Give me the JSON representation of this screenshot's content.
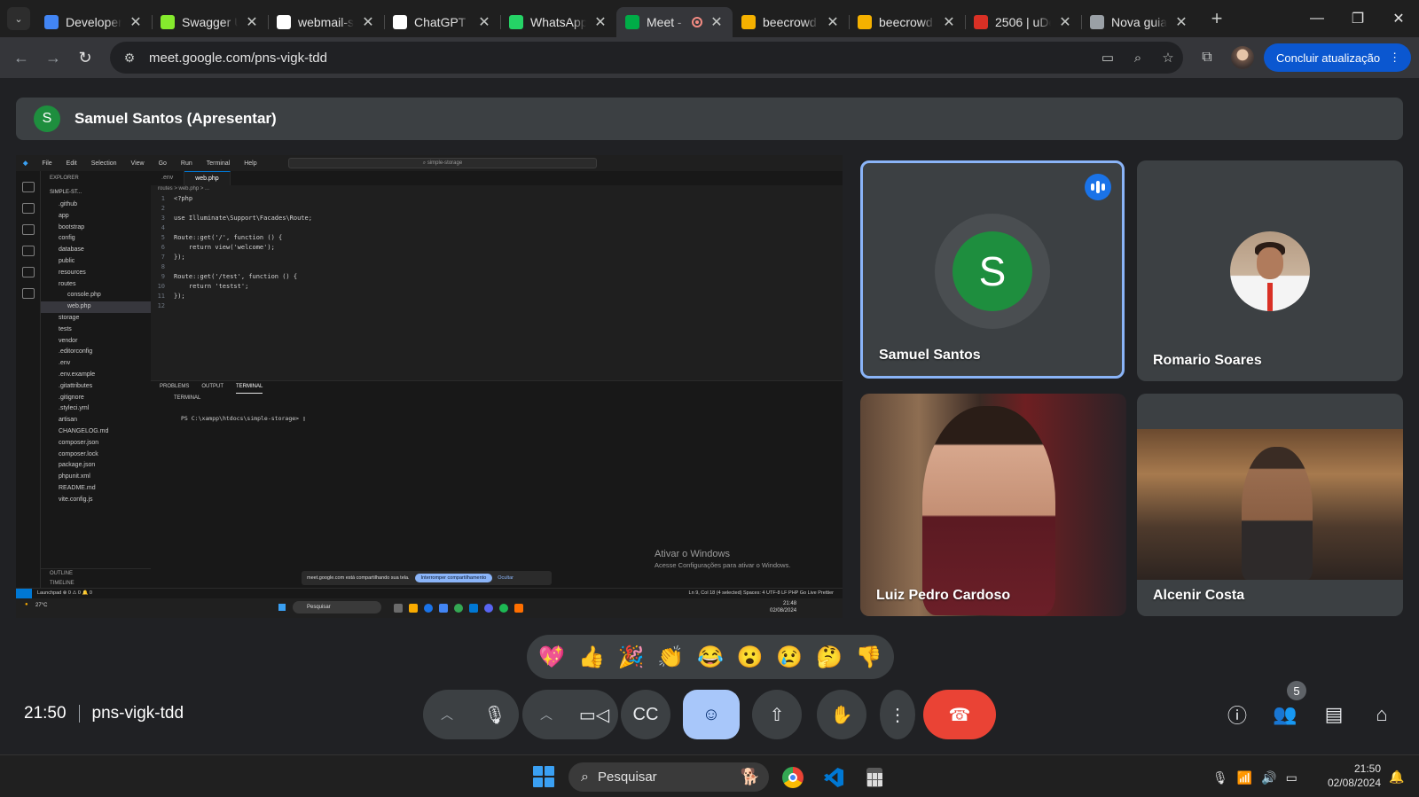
{
  "browser": {
    "tabs": [
      {
        "title": "Developer",
        "favicon": "developer-icon",
        "color": "#4285f4",
        "active": false
      },
      {
        "title": "Swagger U",
        "favicon": "swagger-icon",
        "color": "#85ea2d",
        "active": false
      },
      {
        "title": "webmail-s",
        "favicon": "webmail-icon",
        "color": "#ffffff",
        "active": false
      },
      {
        "title": "ChatGPT",
        "favicon": "chatgpt-icon",
        "color": "#ffffff",
        "active": false
      },
      {
        "title": "WhatsApp",
        "favicon": "whatsapp-icon",
        "color": "#25d366",
        "active": false
      },
      {
        "title": "Meet -",
        "favicon": "meet-icon",
        "color": "#00ac47",
        "active": true
      },
      {
        "title": "beecrowd",
        "favicon": "beecrowd-icon",
        "color": "#f5b100",
        "active": false
      },
      {
        "title": "beecrowd",
        "favicon": "beecrowd-icon",
        "color": "#f5b100",
        "active": false
      },
      {
        "title": "2506 | uDe",
        "favicon": "udebug-icon",
        "color": "#d93025",
        "active": false
      },
      {
        "title": "Nova guia",
        "favicon": "chrome-icon",
        "color": "#9aa0a6",
        "active": false
      }
    ],
    "url": "meet.google.com/pns-vigk-tdd",
    "update_label": "Concluir atualização"
  },
  "meet": {
    "presenter_initial": "S",
    "presenter_label": "Samuel Santos (Apresentar)",
    "participants": [
      {
        "name": "Samuel Santos",
        "initial": "S",
        "speaking": true
      },
      {
        "name": "Romario Soares"
      },
      {
        "name": "Luiz Pedro Cardoso"
      },
      {
        "name": "Alcenir Costa"
      }
    ],
    "reactions": [
      "💖",
      "👍",
      "🎉",
      "👏",
      "😂",
      "😮",
      "😢",
      "🤔",
      "👎"
    ],
    "time": "21:50",
    "meeting_code": "pns-vigk-tdd",
    "people_count": "5",
    "accent": "#a8c7fa",
    "end_call_color": "#ea4335"
  },
  "shared_screen": {
    "menu": [
      "File",
      "Edit",
      "Selection",
      "View",
      "Go",
      "Run",
      "Terminal",
      "Help"
    ],
    "search": "simple-storage",
    "explorer_title": "EXPLORER",
    "project": "SIMPLE-ST...",
    "files": [
      ".github",
      "app",
      "bootstrap",
      "config",
      "database",
      "public",
      "resources",
      "routes",
      "console.php",
      "web.php",
      "storage",
      "tests",
      "vendor",
      ".editorconfig",
      ".env",
      ".env.example",
      ".gitattributes",
      ".gitignore",
      ".styleci.yml",
      "artisan",
      "CHANGELOG.md",
      "composer.json",
      "composer.lock",
      "package.json",
      "phpunit.xml",
      "README.md",
      "vite.config.js"
    ],
    "outline": "OUTLINE",
    "timeline": "TIMELINE",
    "editor_tabs": [
      ".env",
      "web.php"
    ],
    "breadcrumb": "routes > web.php > ...",
    "code": [
      "<?php",
      "",
      "use Illuminate\\Support\\Facades\\Route;",
      "",
      "Route::get('/', function () {",
      "    return view('welcome');",
      "});",
      "",
      "Route::get('/test', function () {",
      "    return 'testst';",
      "});",
      ""
    ],
    "panel_tabs": [
      "PROBLEMS",
      "OUTPUT",
      "TERMINAL"
    ],
    "terminal_title": "TERMINAL",
    "prompt": "PS C:\\xampp\\htdocs\\simple-storage>",
    "activate_title": "Ativar o Windows",
    "activate_sub": "Acesse Configurações para ativar o Windows.",
    "share_notice": "meet.google.com está compartilhando sua tela.",
    "stop_share": "Interromper compartilhamento",
    "hide": "Ocultar",
    "status_left": "Launchpad  ⊗ 0 ⚠ 0  🔔 0",
    "status_right": "Ln 9, Col 18 (4 selected)   Spaces: 4   UTF-8   LF   PHP   Go Live   Prettier",
    "weather": "27°C",
    "taskbar_search": "Pesquisar",
    "mini_clock": "21:48",
    "mini_date": "02/08/2024"
  },
  "taskbar": {
    "search_placeholder": "Pesquisar",
    "time": "21:50",
    "date": "02/08/2024"
  }
}
